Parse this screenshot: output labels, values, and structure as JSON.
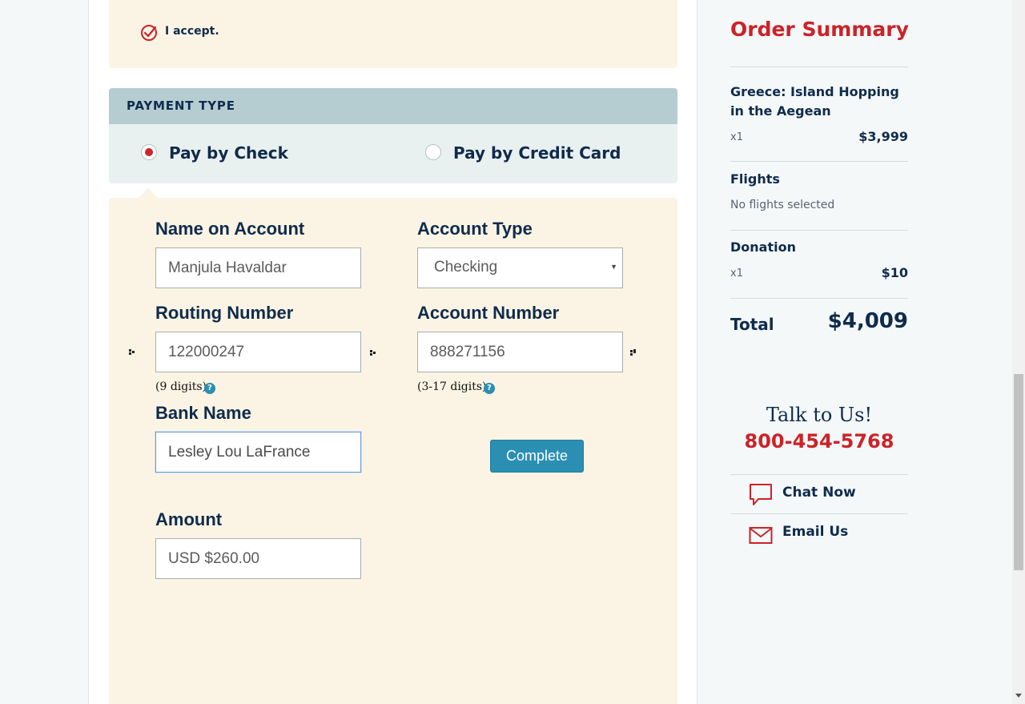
{
  "agreement": {
    "accept_label": "I accept."
  },
  "payment": {
    "header": "PAYMENT TYPE",
    "options": [
      {
        "label": "Pay by Check",
        "selected": true
      },
      {
        "label": "Pay by Credit Card",
        "selected": false
      }
    ]
  },
  "form": {
    "name_label": "Name on Account",
    "name_value": "Manjula Havaldar",
    "account_type_label": "Account Type",
    "account_type_value": "Checking",
    "routing_label": "Routing Number",
    "routing_value": "122000247",
    "routing_hint": "(9 digits)",
    "account_number_label": "Account Number",
    "account_number_value": "888271156",
    "account_number_hint": "(3-17 digits)",
    "bank_label": "Bank Name",
    "bank_value": "Lesley Lou LaFrance",
    "amount_label": "Amount",
    "amount_value": "USD $260.00",
    "help_glyph": "?",
    "complete_label": "Complete"
  },
  "summary": {
    "title": "Order Summary",
    "trip": {
      "name": "Greece: Island Hopping in the Aegean",
      "qty": "x1",
      "price": "$3,999"
    },
    "flights": {
      "label": "Flights",
      "note": "No flights selected"
    },
    "donation": {
      "label": "Donation",
      "qty": "x1",
      "price": "$10"
    },
    "total_label": "Total",
    "total_value": "$4,009"
  },
  "contact": {
    "title": "Talk to Us!",
    "phone": "800-454-5768",
    "chat_label": "Chat Now",
    "email_label": "Email Us"
  },
  "colors": {
    "accent_red": "#cc2229",
    "navy": "#0f2b4c",
    "button_blue": "#2a8fb3",
    "panel_cream": "#fbf4e4",
    "header_teal": "#b5cdd1"
  },
  "icons": [
    "check-circle-icon",
    "radio-selected-icon",
    "radio-unselected-icon",
    "help-icon",
    "chat-bubble-icon",
    "envelope-icon",
    "dropdown-arrow-icon"
  ]
}
